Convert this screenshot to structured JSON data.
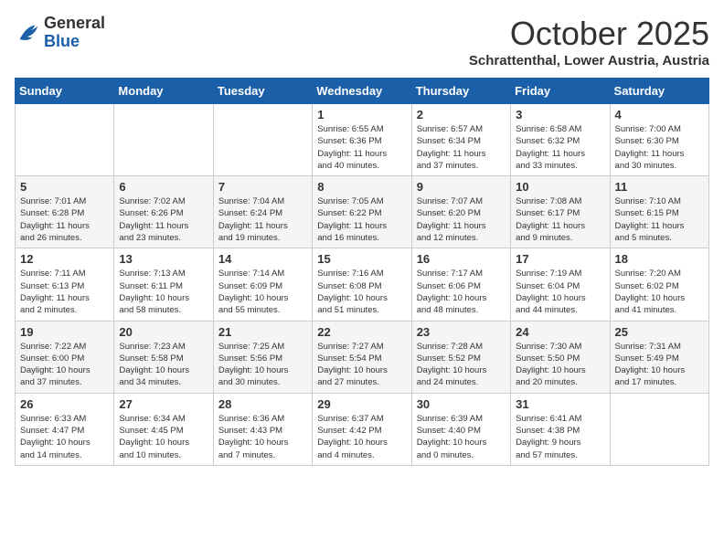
{
  "header": {
    "logo_general": "General",
    "logo_blue": "Blue",
    "month_title": "October 2025",
    "location": "Schrattenthal, Lower Austria, Austria"
  },
  "days_of_week": [
    "Sunday",
    "Monday",
    "Tuesday",
    "Wednesday",
    "Thursday",
    "Friday",
    "Saturday"
  ],
  "weeks": [
    [
      {
        "day": "",
        "info": ""
      },
      {
        "day": "",
        "info": ""
      },
      {
        "day": "",
        "info": ""
      },
      {
        "day": "1",
        "info": "Sunrise: 6:55 AM\nSunset: 6:36 PM\nDaylight: 11 hours\nand 40 minutes."
      },
      {
        "day": "2",
        "info": "Sunrise: 6:57 AM\nSunset: 6:34 PM\nDaylight: 11 hours\nand 37 minutes."
      },
      {
        "day": "3",
        "info": "Sunrise: 6:58 AM\nSunset: 6:32 PM\nDaylight: 11 hours\nand 33 minutes."
      },
      {
        "day": "4",
        "info": "Sunrise: 7:00 AM\nSunset: 6:30 PM\nDaylight: 11 hours\nand 30 minutes."
      }
    ],
    [
      {
        "day": "5",
        "info": "Sunrise: 7:01 AM\nSunset: 6:28 PM\nDaylight: 11 hours\nand 26 minutes."
      },
      {
        "day": "6",
        "info": "Sunrise: 7:02 AM\nSunset: 6:26 PM\nDaylight: 11 hours\nand 23 minutes."
      },
      {
        "day": "7",
        "info": "Sunrise: 7:04 AM\nSunset: 6:24 PM\nDaylight: 11 hours\nand 19 minutes."
      },
      {
        "day": "8",
        "info": "Sunrise: 7:05 AM\nSunset: 6:22 PM\nDaylight: 11 hours\nand 16 minutes."
      },
      {
        "day": "9",
        "info": "Sunrise: 7:07 AM\nSunset: 6:20 PM\nDaylight: 11 hours\nand 12 minutes."
      },
      {
        "day": "10",
        "info": "Sunrise: 7:08 AM\nSunset: 6:17 PM\nDaylight: 11 hours\nand 9 minutes."
      },
      {
        "day": "11",
        "info": "Sunrise: 7:10 AM\nSunset: 6:15 PM\nDaylight: 11 hours\nand 5 minutes."
      }
    ],
    [
      {
        "day": "12",
        "info": "Sunrise: 7:11 AM\nSunset: 6:13 PM\nDaylight: 11 hours\nand 2 minutes."
      },
      {
        "day": "13",
        "info": "Sunrise: 7:13 AM\nSunset: 6:11 PM\nDaylight: 10 hours\nand 58 minutes."
      },
      {
        "day": "14",
        "info": "Sunrise: 7:14 AM\nSunset: 6:09 PM\nDaylight: 10 hours\nand 55 minutes."
      },
      {
        "day": "15",
        "info": "Sunrise: 7:16 AM\nSunset: 6:08 PM\nDaylight: 10 hours\nand 51 minutes."
      },
      {
        "day": "16",
        "info": "Sunrise: 7:17 AM\nSunset: 6:06 PM\nDaylight: 10 hours\nand 48 minutes."
      },
      {
        "day": "17",
        "info": "Sunrise: 7:19 AM\nSunset: 6:04 PM\nDaylight: 10 hours\nand 44 minutes."
      },
      {
        "day": "18",
        "info": "Sunrise: 7:20 AM\nSunset: 6:02 PM\nDaylight: 10 hours\nand 41 minutes."
      }
    ],
    [
      {
        "day": "19",
        "info": "Sunrise: 7:22 AM\nSunset: 6:00 PM\nDaylight: 10 hours\nand 37 minutes."
      },
      {
        "day": "20",
        "info": "Sunrise: 7:23 AM\nSunset: 5:58 PM\nDaylight: 10 hours\nand 34 minutes."
      },
      {
        "day": "21",
        "info": "Sunrise: 7:25 AM\nSunset: 5:56 PM\nDaylight: 10 hours\nand 30 minutes."
      },
      {
        "day": "22",
        "info": "Sunrise: 7:27 AM\nSunset: 5:54 PM\nDaylight: 10 hours\nand 27 minutes."
      },
      {
        "day": "23",
        "info": "Sunrise: 7:28 AM\nSunset: 5:52 PM\nDaylight: 10 hours\nand 24 minutes."
      },
      {
        "day": "24",
        "info": "Sunrise: 7:30 AM\nSunset: 5:50 PM\nDaylight: 10 hours\nand 20 minutes."
      },
      {
        "day": "25",
        "info": "Sunrise: 7:31 AM\nSunset: 5:49 PM\nDaylight: 10 hours\nand 17 minutes."
      }
    ],
    [
      {
        "day": "26",
        "info": "Sunrise: 6:33 AM\nSunset: 4:47 PM\nDaylight: 10 hours\nand 14 minutes."
      },
      {
        "day": "27",
        "info": "Sunrise: 6:34 AM\nSunset: 4:45 PM\nDaylight: 10 hours\nand 10 minutes."
      },
      {
        "day": "28",
        "info": "Sunrise: 6:36 AM\nSunset: 4:43 PM\nDaylight: 10 hours\nand 7 minutes."
      },
      {
        "day": "29",
        "info": "Sunrise: 6:37 AM\nSunset: 4:42 PM\nDaylight: 10 hours\nand 4 minutes."
      },
      {
        "day": "30",
        "info": "Sunrise: 6:39 AM\nSunset: 4:40 PM\nDaylight: 10 hours\nand 0 minutes."
      },
      {
        "day": "31",
        "info": "Sunrise: 6:41 AM\nSunset: 4:38 PM\nDaylight: 9 hours\nand 57 minutes."
      },
      {
        "day": "",
        "info": ""
      }
    ]
  ]
}
